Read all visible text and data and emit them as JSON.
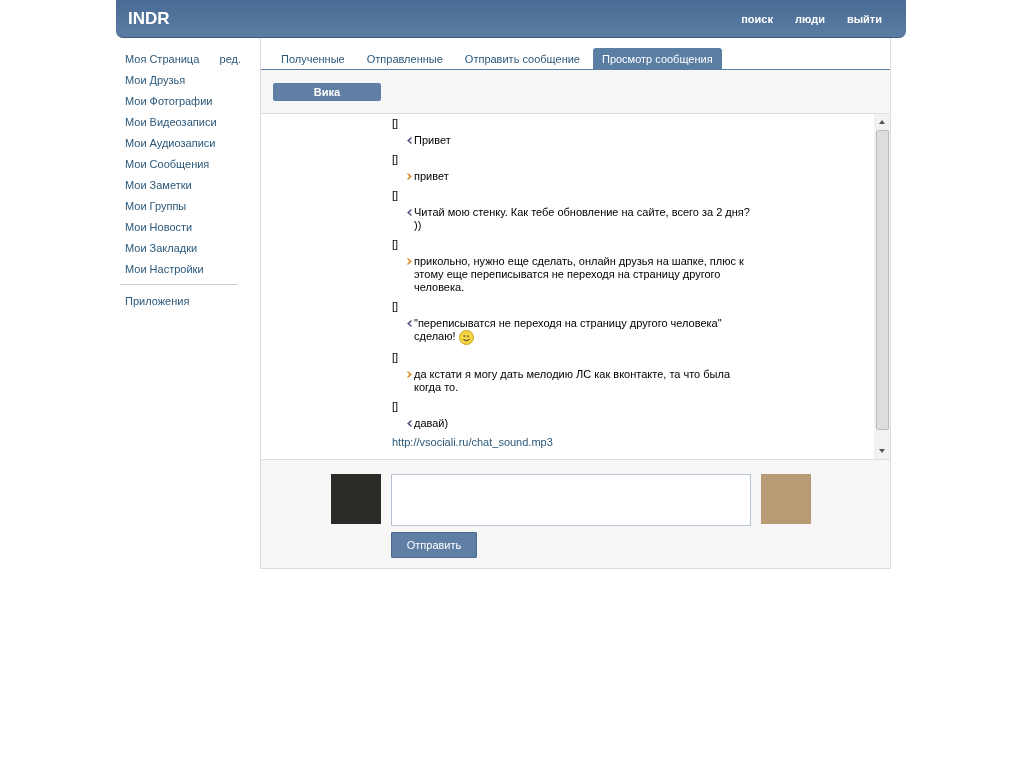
{
  "header": {
    "logo": "INDR",
    "links": [
      "поиск",
      "люди",
      "выйти"
    ]
  },
  "sidebar": {
    "items": [
      {
        "label": "Моя Страница",
        "extra": "ред."
      },
      {
        "label": "Мои Друзья"
      },
      {
        "label": "Мои Фотографии"
      },
      {
        "label": "Мои Видеозаписи"
      },
      {
        "label": "Мои Аудиозаписи"
      },
      {
        "label": "Мои Сообщения"
      },
      {
        "label": "Мои Заметки"
      },
      {
        "label": "Мои Группы"
      },
      {
        "label": "Мои Новости"
      },
      {
        "label": "Мои Закладки"
      },
      {
        "label": "Мои Настройки"
      }
    ],
    "after_divider": [
      {
        "label": "Приложения"
      }
    ]
  },
  "tabs": [
    {
      "label": "Полученные",
      "selected": false
    },
    {
      "label": "Отправленные",
      "selected": false
    },
    {
      "label": "Отправить сообщение",
      "selected": false
    },
    {
      "label": "Просмотр сообщения",
      "selected": true
    }
  ],
  "contact": "Вика",
  "messages": [
    {
      "marker": "[]",
      "kind": "in",
      "text": "Привет",
      "emoticon": false
    },
    {
      "marker": "[]",
      "kind": "out",
      "text": "привет",
      "emoticon": false
    },
    {
      "marker": "[]",
      "kind": "in",
      "text": "Читай мою стенку. Как тебе обновление на сайте, всего за 2 дня? ))",
      "emoticon": false
    },
    {
      "marker": "[]",
      "kind": "out",
      "text": "прикольно, нужно еще сделать, онлайн друзья на шапке, плюс к этому еще переписыватся не переходя на страницу другого человека.",
      "emoticon": false
    },
    {
      "marker": "[]",
      "kind": "in",
      "text": "\"переписыватся не переходя на страницу другого человека\" сделаю!",
      "emoticon": true
    },
    {
      "marker": "[]",
      "kind": "out",
      "text": "да кстати я могу дать мелодию ЛС как вконтакте, та что была когда то.",
      "emoticon": false
    },
    {
      "marker": "[]",
      "kind": "in",
      "text": "давай)",
      "emoticon": false
    }
  ],
  "link": "http://vsociali.ru/chat_sound.mp3",
  "send_button": "Отправить"
}
